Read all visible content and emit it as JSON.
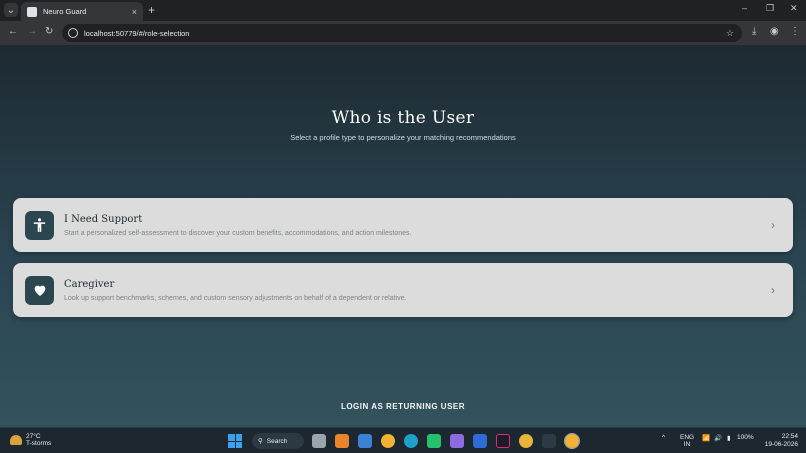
{
  "browser": {
    "tab_title": "Neuro Guard",
    "tab_close": "×",
    "new_tab": "+",
    "url": "localhost:50779/#/role-selection",
    "window_controls": {
      "minimize": "–",
      "restore": "❐",
      "close": "✕"
    }
  },
  "page": {
    "title": "Who is the User",
    "subtitle": "Select a profile type to personalize your matching recommendations",
    "cards": [
      {
        "title": "I Need Support",
        "description": "Start a personalized self-assessment to discover your custom benefits, accommodations, and action milestones.",
        "icon": "accessibility-icon"
      },
      {
        "title": "Caregiver",
        "description": "Look up support benchmarks, schemes, and custom sensory adjustments on behalf of a dependent or relative.",
        "icon": "heart-icon"
      }
    ],
    "login_label": "LOGIN AS RETURNING USER"
  },
  "taskbar": {
    "weather_temp": "27°C",
    "weather_desc": "T-storms",
    "search_label": "Search",
    "language": "ENG",
    "region": "IN",
    "battery": "100%",
    "time": "22:54",
    "date": "19-06-2026"
  },
  "colors": {
    "card_bg": "#dcdcdc",
    "icon_bg": "#2c4650",
    "accent_windows": "#3aa0f0"
  }
}
